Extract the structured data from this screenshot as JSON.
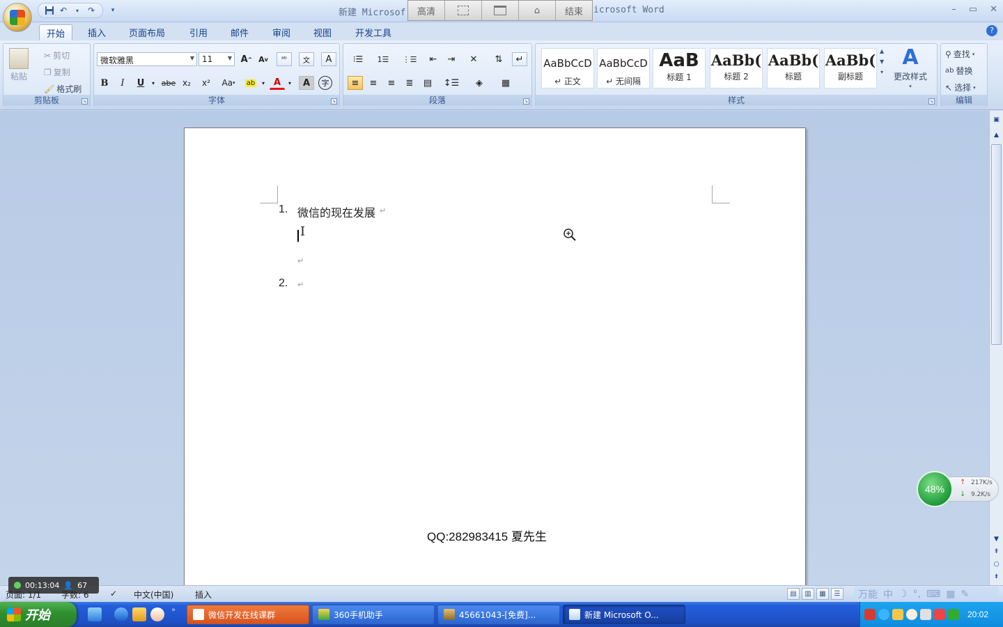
{
  "window": {
    "title_prefix": "新建 Microsof",
    "title_suffix": "icrosoft Word"
  },
  "recorder_toolbar": [
    "高清",
    "",
    "",
    "",
    "结束"
  ],
  "quick_access": {
    "icons": [
      "save-icon",
      "undo-icon",
      "redo-icon",
      "customize-icon"
    ]
  },
  "tabs": [
    {
      "label": "开始",
      "active": true
    },
    {
      "label": "插入"
    },
    {
      "label": "页面布局"
    },
    {
      "label": "引用"
    },
    {
      "label": "邮件"
    },
    {
      "label": "审阅"
    },
    {
      "label": "视图"
    },
    {
      "label": "开发工具"
    }
  ],
  "clipboard": {
    "paste": "粘贴",
    "cut": "剪切",
    "copy": "复制",
    "format_painter": "格式刷",
    "label": "剪贴板"
  },
  "font": {
    "name": "微软雅黑",
    "size": "11",
    "label": "字体",
    "bold": "B",
    "italic": "I",
    "underline": "U",
    "strike": "abe",
    "subscript": "x₂",
    "superscript": "x²",
    "change_case": "Aa",
    "grow": "A",
    "shrink": "A",
    "font_color": "A",
    "char_shading": "A"
  },
  "paragraph": {
    "label": "段落"
  },
  "styles": {
    "label": "样式",
    "items": [
      {
        "sample": "AaBbCcD",
        "name": "↵ 正文"
      },
      {
        "sample": "AaBbCcD",
        "name": "↵ 无间隔"
      },
      {
        "sample": "AaB",
        "name": "标题 1"
      },
      {
        "sample": "AaBb(",
        "name": "标题 2"
      },
      {
        "sample": "AaBb(",
        "name": "标题"
      },
      {
        "sample": "AaBb(",
        "name": "副标题"
      }
    ],
    "change_styles": "更改样式"
  },
  "editing": {
    "find": "查找",
    "replace": "替换",
    "select": "选择",
    "label": "编辑"
  },
  "document": {
    "items": [
      {
        "num": "1.",
        "text": "微信的现在发展"
      },
      {
        "num": "2.",
        "text": ""
      }
    ],
    "para_mark": "↵",
    "footer": "QQ:282983415 夏先生"
  },
  "speed_widget": {
    "percent": "48%",
    "up": "217K/s",
    "down": "9.2K/s"
  },
  "statusbar": {
    "page": "页面: 1/1",
    "words": "字数: 6",
    "language": "中文(中国)",
    "mode": "插入",
    "recording_time": "00:13:04",
    "viewers": "67"
  },
  "taskbar": {
    "start": "开始",
    "tasks": [
      {
        "label": "微信开发在线课群",
        "color": "#e2572a"
      },
      {
        "label": "360手机助手",
        "color": "#3a7be0"
      },
      {
        "label": "45661043-[免费]...",
        "color": "#3a7be0"
      },
      {
        "label": "新建 Microsoft O...",
        "color": "#1a48b8"
      }
    ],
    "clock": "20:02"
  }
}
